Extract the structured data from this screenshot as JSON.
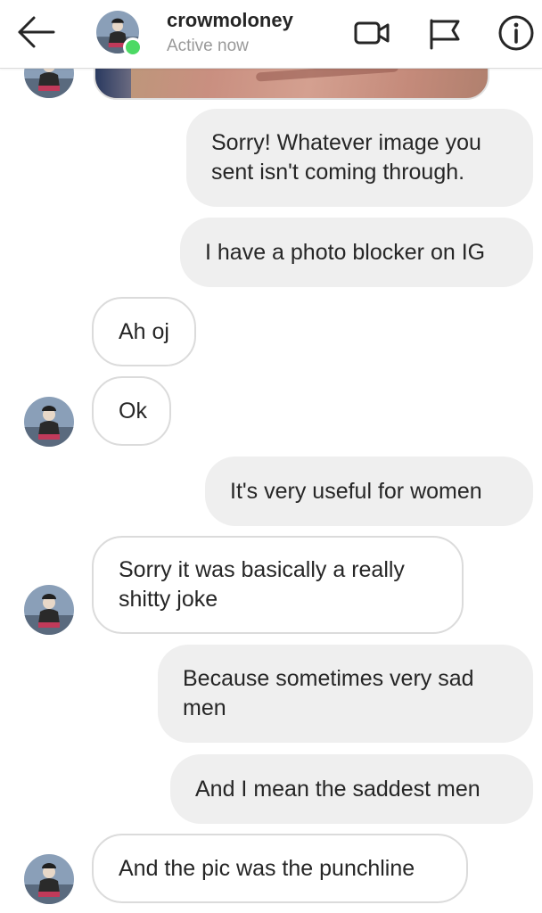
{
  "header": {
    "username": "crowmoloney",
    "status": "Active now",
    "status_color": "#4cd964"
  },
  "icons": {
    "back": "arrow-left-icon",
    "video": "video-camera-icon",
    "flag": "flag-icon",
    "info": "info-icon"
  },
  "messages": [
    {
      "from": "me",
      "text": "Sorry! Whatever image you sent isn't coming through."
    },
    {
      "from": "me",
      "text": "I have a photo blocker on IG"
    },
    {
      "from": "them",
      "text": "Ah oj"
    },
    {
      "from": "them",
      "text": "Ok"
    },
    {
      "from": "me",
      "text": "It's very useful for women"
    },
    {
      "from": "them",
      "text": "Sorry it was basically a really shitty joke"
    },
    {
      "from": "me",
      "text": "Because sometimes very sad men"
    },
    {
      "from": "me",
      "text": "And I mean the saddest men"
    },
    {
      "from": "them",
      "text": "And the pic was the punchline"
    }
  ],
  "colors": {
    "sent_bubble": "#efefef",
    "received_border": "#dbdbdb",
    "online": "#4cd964"
  }
}
